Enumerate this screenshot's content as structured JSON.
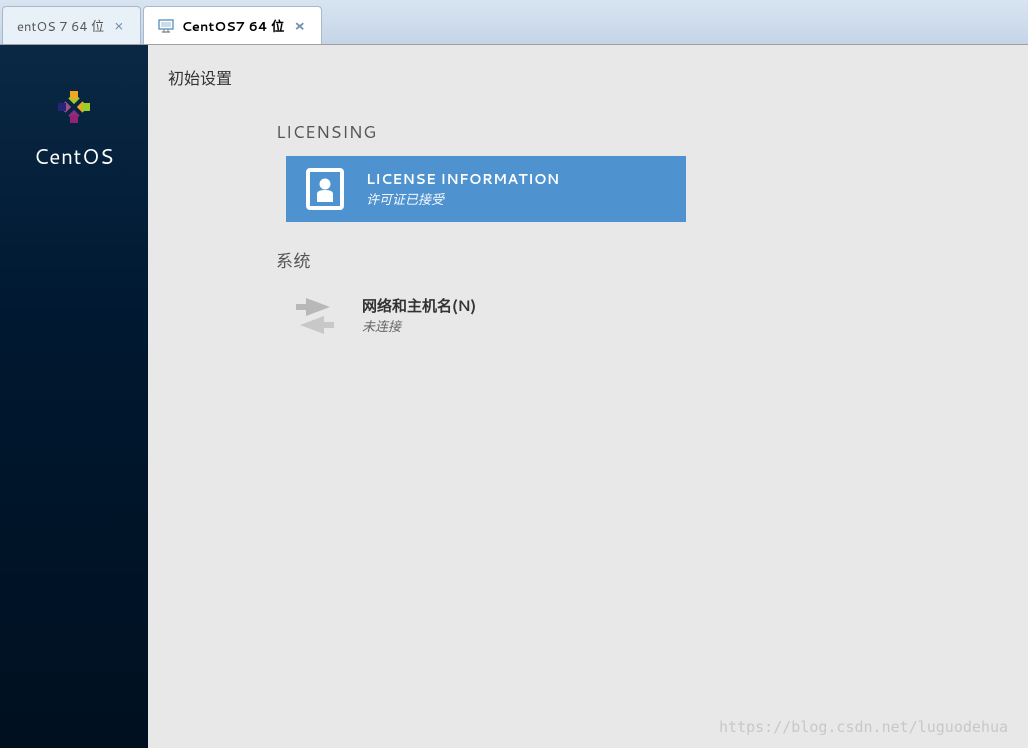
{
  "tabs": [
    {
      "label": "entOS 7 64 位",
      "active": false
    },
    {
      "label": "CentOS7 64 位",
      "active": true
    }
  ],
  "sidebar": {
    "brand": "CentOS"
  },
  "content": {
    "page_title": "初始设置",
    "sections": [
      {
        "heading": "LICENSING",
        "items": [
          {
            "type": "card",
            "title": "LICENSE INFORMATION",
            "subtitle": "许可证已接受"
          }
        ]
      },
      {
        "heading": "系统",
        "items": [
          {
            "type": "item",
            "title": "网络和主机名(N)",
            "subtitle": "未连接"
          }
        ]
      }
    ]
  },
  "watermark": "https://blog.csdn.net/luguodehua"
}
